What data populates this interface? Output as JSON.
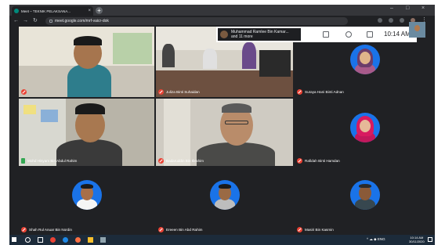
{
  "browser": {
    "tab_title": "Meet – TEKNIK PELAKSANA...",
    "tab_close": "×",
    "new_tab": "+",
    "window_controls": [
      "–",
      "□",
      "×"
    ],
    "url": "meet.google.com/mrf-vaicr-dok"
  },
  "meet": {
    "presenter_name": "Muhammad Ramlee Bin Kamar...",
    "presenter_more": "and 11 more",
    "time": "10:14 AM"
  },
  "participants": [
    {
      "name": "",
      "mic": "muted"
    },
    {
      "name": "Juliza Binti Suhaidan",
      "mic": "muted"
    },
    {
      "name": "Suraya Hani Binti Adnan",
      "mic": "muted"
    },
    {
      "name": "Mohd Hisyam Bin Abdul Rahim",
      "mic": "on"
    },
    {
      "name": "Badaruddin Bin Ibrahim",
      "mic": "muted"
    },
    {
      "name": "Rafidah Binti Hamdan",
      "mic": "muted"
    },
    {
      "name": "Shah Rul Anuar Bin Nordin",
      "mic": "muted"
    },
    {
      "name": "Ereeen Bin Abd Rahim",
      "mic": "muted"
    },
    {
      "name": "Masiri Bin Kasmin",
      "mic": "muted"
    }
  ],
  "taskbar": {
    "clock_time": "10:14 AM",
    "clock_date": "30/11/2020",
    "tray_text": "^ ☁ ◆ ENG"
  },
  "colors": {
    "avatar_bg": "#1a73e8",
    "mic_muted": "#ea4335",
    "mic_on": "#34a853"
  }
}
